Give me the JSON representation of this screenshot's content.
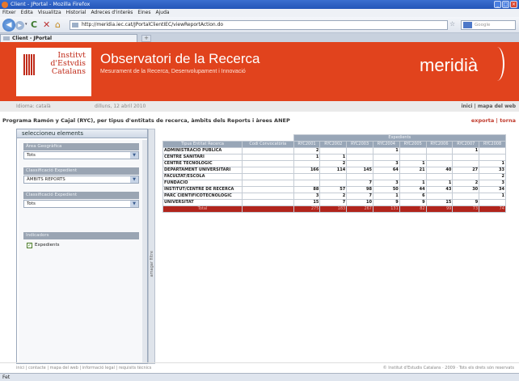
{
  "window": {
    "title": "Client - JPortal - Mozilla Firefox"
  },
  "menu": [
    "Fitxer",
    "Edita",
    "Visualitza",
    "Historial",
    "Adreces d'interès",
    "Eines",
    "Ajuda"
  ],
  "nav": {
    "url": "http://meridia.iec.cat/JPortalClientIEC/viewReportAction.do",
    "search_placeholder": "Google"
  },
  "tab": {
    "label": "Client - JPortal"
  },
  "header": {
    "logo_text": [
      "Institvt",
      "d'Estvdis",
      "Catalans"
    ],
    "title": "Observatori de la Recerca",
    "subtitle": "Mesurament de la Recerca, Desenvolupament i Innovació",
    "brand": "meridià"
  },
  "infobar": {
    "language": "Idioma: català",
    "date": "dilluns, 12 abril 2010",
    "links": "inici  |  mapa del web"
  },
  "report": {
    "heading": "Programa Ramón y Cajal (RYC), per tipus d'entitats de recerca, àmbits dels Reports i àrees ANEP",
    "actions": "exporta | torna"
  },
  "panel": {
    "title": "seleccioneu elements",
    "filters": [
      {
        "label": "Àrea Geogràfica",
        "value": "Tots"
      },
      {
        "label": "Classificació Expedient",
        "value": "ÀMBITS REPORTS"
      },
      {
        "label": "Classificació Expedient",
        "value": "Tots"
      }
    ],
    "indicators_label": "Indicadors",
    "indicator": "Expedients",
    "collapse_label": "amagar filtre"
  },
  "table": {
    "group_header": "Expedients",
    "col_label": "Tipus Entitat Recerca",
    "col_conv": "Codi Convocatòria",
    "years": [
      "RYC2001",
      "RYC2002",
      "RYC2003",
      "RYC2004",
      "RYC2005",
      "RYC2006",
      "RYC2007",
      "RYC2008"
    ],
    "rows": [
      {
        "name": "ADMINISTRACIÓ PÚBLICA",
        "values": [
          "2",
          "",
          "",
          "1",
          "",
          "",
          "1",
          ""
        ]
      },
      {
        "name": "CENTRE SANITARI",
        "values": [
          "1",
          "1",
          "",
          "",
          "",
          "",
          "",
          ""
        ]
      },
      {
        "name": "CENTRE TECNOLÒGIC",
        "values": [
          "",
          "2",
          "",
          "3",
          "1",
          "",
          "",
          "1"
        ]
      },
      {
        "name": "DEPARTAMENT UNIVERSITARI",
        "values": [
          "166",
          "114",
          "145",
          "64",
          "21",
          "40",
          "27",
          "33"
        ]
      },
      {
        "name": "FACULTAT/ESCOLA",
        "values": [
          "",
          "",
          "",
          "",
          "",
          "",
          "",
          "2"
        ]
      },
      {
        "name": "FUNDACIÓ",
        "values": [
          "",
          "",
          "7",
          "3",
          "1",
          "1",
          "2",
          "3"
        ]
      },
      {
        "name": "INSTITUT/CENTRE DE RECERCA",
        "values": [
          "88",
          "57",
          "98",
          "50",
          "44",
          "43",
          "30",
          "34"
        ]
      },
      {
        "name": "PARC CIENTÍFICOTECNOLÒGIC",
        "values": [
          "3",
          "2",
          "7",
          "1",
          "6",
          "",
          "",
          "1"
        ]
      },
      {
        "name": "UNIVERSITAT",
        "values": [
          "15",
          "7",
          "10",
          "9",
          "9",
          "15",
          "9",
          ""
        ]
      }
    ],
    "total": {
      "name": "Total",
      "values": [
        "275",
        "183",
        "267",
        "131",
        "82",
        "99",
        "73",
        "74"
      ]
    }
  },
  "footer": {
    "left": "inici  |  contacte  |  mapa del web  |  informació legal  |  requisits tècnics",
    "right": "© Institut d'Estudis Catalans · 2009 · Tots els drets són reservats"
  },
  "status": "Fet"
}
